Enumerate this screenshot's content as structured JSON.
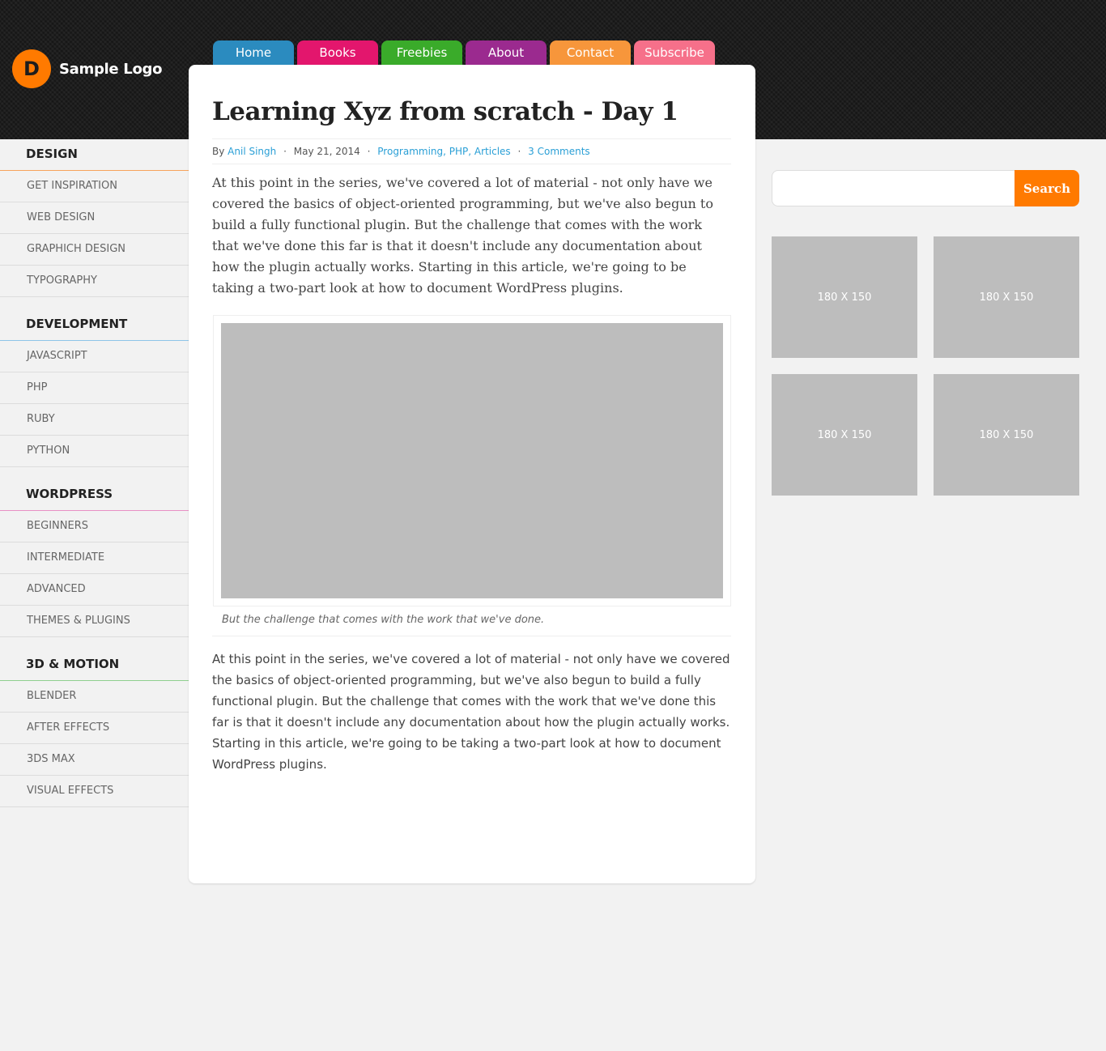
{
  "logo": {
    "mark": "D",
    "text": "Sample Logo"
  },
  "nav": [
    {
      "label": "Home",
      "color": "#2b8bbf"
    },
    {
      "label": "Books",
      "color": "#e3166d"
    },
    {
      "label": "Freebies",
      "color": "#3aab2a"
    },
    {
      "label": "About",
      "color": "#9b2a8f"
    },
    {
      "label": "Contact",
      "color": "#f7963b"
    },
    {
      "label": "Subscribe",
      "color": "#f6708a"
    }
  ],
  "sidebar": [
    {
      "title": "DESIGN",
      "accent": "#f7a35c",
      "items": [
        "GET INSPIRATION",
        "WEB DESIGN",
        "GRAPHICH DESIGN",
        "TYPOGRAPHY"
      ]
    },
    {
      "title": "DEVELOPMENT",
      "accent": "#8ec5e8",
      "items": [
        "JAVASCRIPT",
        "PHP",
        "RUBY",
        "PYTHON"
      ]
    },
    {
      "title": "WORDPRESS",
      "accent": "#e890c5",
      "items": [
        "BEGINNERS",
        "INTERMEDIATE",
        "ADVANCED",
        "THEMES & PLUGINS"
      ]
    },
    {
      "title": "3D & MOTION",
      "accent": "#8fd08f",
      "items": [
        "BLENDER",
        "AFTER EFFECTS",
        "3DS MAX",
        "VISUAL EFFECTS"
      ]
    }
  ],
  "post": {
    "title": "Learning Xyz from scratch - Day 1",
    "by": "By",
    "author": "Anil Singh",
    "date": "May 21, 2014",
    "categories": "Programming, PHP, Articles",
    "comments": "3 Comments",
    "separator": "·",
    "intro": "At this point in the series, we've covered a lot of material - not only have we covered the basics of object-oriented programming, but we've also begun to build a fully functional plugin. But the challenge that comes with the work that we've done this far is that it doesn't include any documentation about how the plugin actually works. Starting in this article, we're going to be taking a two-part look at how to document WordPress plugins.",
    "caption": "But the challenge that comes with the work that we've done.",
    "body": "At this point in the series, we've covered a lot of material - not only have we covered the basics of object-oriented programming, but we've also begun to build a fully functional plugin. But the challenge that comes with the work that we've done this far is that it doesn't include any documentation about how the plugin actually works. Starting in this article, we're going to be taking a two-part look at how to document WordPress plugins."
  },
  "search": {
    "placeholder": "",
    "button_label": "Search",
    "accent": "#ff7a00"
  },
  "ads": [
    "180 X 150",
    "180 X 150",
    "180 X 150",
    "180 X 150"
  ]
}
